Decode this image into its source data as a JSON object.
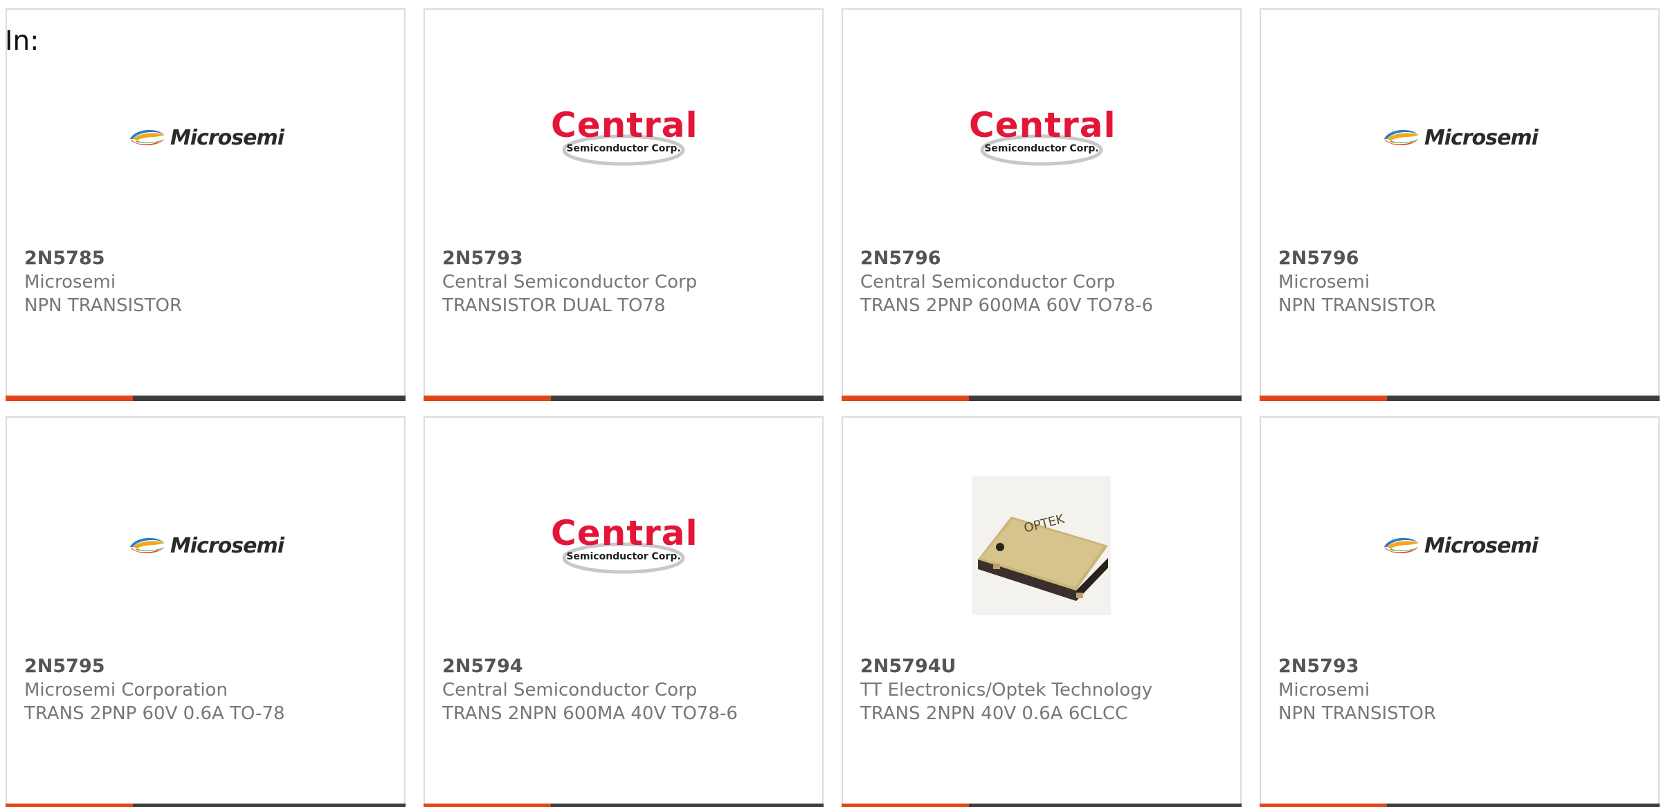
{
  "header": {
    "in_label": "In:"
  },
  "colors": {
    "card_border": "#dcdcdc",
    "bar_dark": "#3d3d3d",
    "bar_accent": "#e2451a",
    "central_red": "#e3163a"
  },
  "products": [
    {
      "part_number": "2N5785",
      "manufacturer": "Microsemi",
      "description": "NPN TRANSISTOR",
      "logo": "microsemi-logo",
      "logo_text": "Microsemi"
    },
    {
      "part_number": "2N5793",
      "manufacturer": "Central Semiconductor Corp",
      "description": "TRANSISTOR DUAL TO78",
      "logo": "central-logo",
      "logo_text": "Central",
      "logo_subtext": "Semiconductor Corp."
    },
    {
      "part_number": "2N5796",
      "manufacturer": "Central Semiconductor Corp",
      "description": "TRANS 2PNP 600MA 60V TO78-6",
      "logo": "central-logo",
      "logo_text": "Central",
      "logo_subtext": "Semiconductor Corp."
    },
    {
      "part_number": "2N5796",
      "manufacturer": "Microsemi",
      "description": "NPN TRANSISTOR",
      "logo": "microsemi-logo",
      "logo_text": "Microsemi"
    },
    {
      "part_number": "2N5795",
      "manufacturer": "Microsemi Corporation",
      "description": "TRANS 2PNP 60V 0.6A TO-78",
      "logo": "microsemi-logo",
      "logo_text": "Microsemi"
    },
    {
      "part_number": "2N5794",
      "manufacturer": "Central Semiconductor Corp",
      "description": "TRANS 2NPN 600MA 40V TO78-6",
      "logo": "central-logo",
      "logo_text": "Central",
      "logo_subtext": "Semiconductor Corp."
    },
    {
      "part_number": "2N5794U",
      "manufacturer": "TT Electronics/Optek Technology",
      "description": "TRANS 2NPN 40V 0.6A 6CLCC",
      "logo": "optek-chip-image",
      "logo_text": "OPTEK"
    },
    {
      "part_number": "2N5793",
      "manufacturer": "Microsemi",
      "description": "NPN TRANSISTOR",
      "logo": "microsemi-logo",
      "logo_text": "Microsemi"
    }
  ]
}
